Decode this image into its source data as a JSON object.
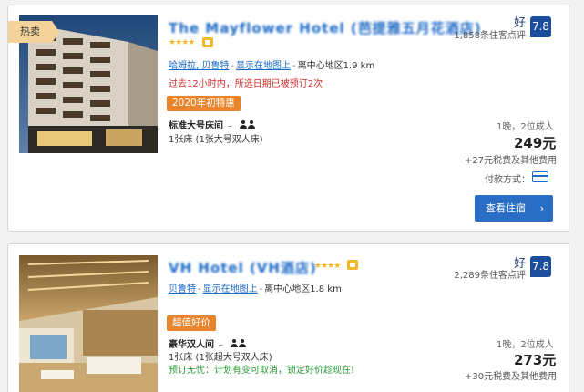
{
  "colors": {
    "accent": "#2a6dc4",
    "link": "#1d6ac6",
    "score_bg": "#1a4e9c",
    "deal_bg": "#e8842b",
    "urgency": "#d0312d",
    "cancel": "#2a9a38",
    "ribbon": "#f4d39a"
  },
  "hotels": [
    {
      "badge": "热卖",
      "name": "The Mayflower Hotel (芭提雅五月花酒店)",
      "stars": "★★★★",
      "location_links": [
        "哈姆拉, 贝鲁特",
        "显示在地图上"
      ],
      "distance": "离中心地区1.9 km",
      "urgency": "过去12小时内，所选日期已被预订2次",
      "deal": "2020年初特惠",
      "room_type": "标准大号床间",
      "room_dash": "–",
      "bed": "1张床 (1张大号双人床)",
      "rating_word": "好",
      "rating_count": "1,858条住客点评",
      "score": "7.8",
      "occupancy": "1晚，2位成人",
      "price": "249元",
      "tax": "+27元税费及其他费用",
      "pay_label": "付款方式：",
      "button": "查看住宿",
      "button_icon": "›"
    },
    {
      "name": "VH Hotel (VH酒店)",
      "stars": "★★★★",
      "location_links": [
        "贝鲁特",
        "显示在地图上"
      ],
      "distance": "离中心地区1.8 km",
      "deal": "超值好价",
      "room_type": "豪华双人间",
      "room_dash": "–",
      "bed": "1张床 (1张超大号双人床)",
      "cancel": "预订无忧：计划有变可取消，锁定好价趁现在!",
      "rating_word": "好",
      "rating_count": "2,289条住客点评",
      "score": "7.8",
      "occupancy": "1晚，2位成人",
      "price": "273元",
      "tax": "+30元税费及其他费用"
    }
  ]
}
